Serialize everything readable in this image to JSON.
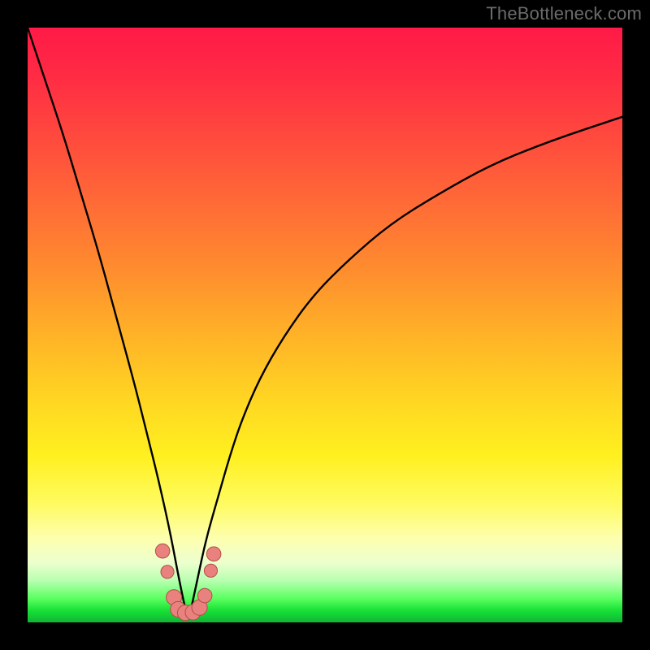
{
  "watermark": "TheBottleneck.com",
  "colors": {
    "frame": "#000000",
    "gradient_top": "#ff1a47",
    "gradient_mid": "#ffd722",
    "gradient_bottom": "#0fb536",
    "curve_stroke": "#000000",
    "marker_fill": "#e9827f",
    "marker_stroke": "#b34c48"
  },
  "chart_data": {
    "type": "line",
    "title": "",
    "xlabel": "",
    "ylabel": "",
    "xlim": [
      0,
      100
    ],
    "ylim": [
      0,
      100
    ],
    "note": "Values are read in percent of plot width (x) and plot height from top (y). Lower y = higher on screen. Minimum of the V-curve sits near x≈27 at the bottom (y≈100).",
    "series": [
      {
        "name": "bottleneck-curve",
        "x": [
          0,
          3,
          6,
          9,
          12,
          15,
          18,
          20,
          22,
          24,
          25.5,
          27,
          28.5,
          30,
          32,
          34,
          36,
          39,
          43,
          48,
          54,
          61,
          69,
          78,
          88,
          100
        ],
        "y": [
          0,
          9,
          18,
          28,
          38,
          49,
          60,
          68,
          76,
          85,
          93,
          100,
          93,
          86,
          79,
          72,
          66,
          59,
          52,
          45,
          39,
          33,
          28,
          23,
          19,
          15
        ]
      }
    ],
    "markers": [
      {
        "x": 22.7,
        "y": 88.0,
        "r": 1.2
      },
      {
        "x": 23.5,
        "y": 91.5,
        "r": 1.1
      },
      {
        "x": 24.6,
        "y": 95.8,
        "r": 1.3
      },
      {
        "x": 25.3,
        "y": 97.8,
        "r": 1.3
      },
      {
        "x": 26.5,
        "y": 98.4,
        "r": 1.3
      },
      {
        "x": 27.8,
        "y": 98.3,
        "r": 1.3
      },
      {
        "x": 28.9,
        "y": 97.5,
        "r": 1.3
      },
      {
        "x": 29.8,
        "y": 95.5,
        "r": 1.2
      },
      {
        "x": 30.8,
        "y": 91.3,
        "r": 1.1
      },
      {
        "x": 31.3,
        "y": 88.5,
        "r": 1.2
      }
    ]
  }
}
